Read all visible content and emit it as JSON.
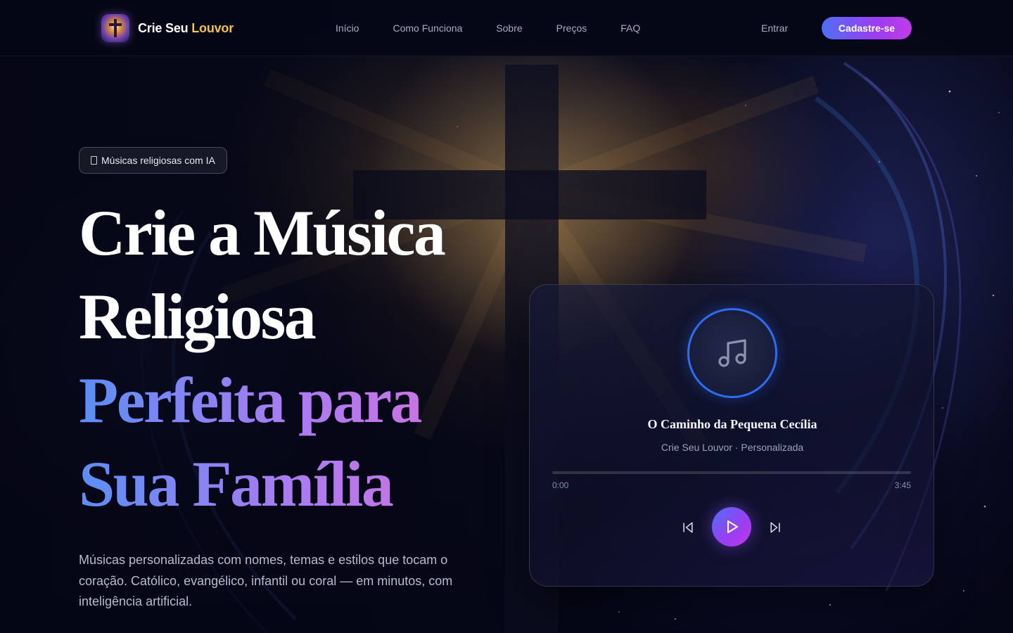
{
  "brand": {
    "name_main": "Crie Seu ",
    "name_accent": "Louvor"
  },
  "nav": {
    "items": [
      {
        "label": "Início"
      },
      {
        "label": "Como Funciona"
      },
      {
        "label": "Sobre"
      },
      {
        "label": "Preços"
      },
      {
        "label": "FAQ"
      }
    ],
    "login_label": "Entrar",
    "signup_label": "Cadastre-se"
  },
  "hero": {
    "badge": "Músicas religiosas com IA",
    "headline_line1": "Crie a Música",
    "headline_line2": "Religiosa",
    "headline_line3": "Perfeita para",
    "headline_line4": "Sua Família",
    "lead": "Músicas personalizadas com nomes, temas e estilos que tocam o coração. Católico, evangélico, infantil ou coral — em minutos, com inteligência artificial."
  },
  "player": {
    "title": "O Caminho da Pequena Cecília",
    "subtitle": "Crie Seu Louvor · Personalizada",
    "time_current": "0:00",
    "time_total": "3:45",
    "progress": 0,
    "icons": {
      "cover": "music-note-icon",
      "prev": "skip-previous-icon",
      "play": "play-icon",
      "next": "skip-next-icon"
    }
  },
  "colors": {
    "background": "#06081a",
    "accent_gold": "#f5c243",
    "gradient_blue": "#4f6ff5",
    "gradient_purple": "#9b3df2",
    "gradient_pink": "#c13be8",
    "ring_blue": "#2f6cf2"
  }
}
